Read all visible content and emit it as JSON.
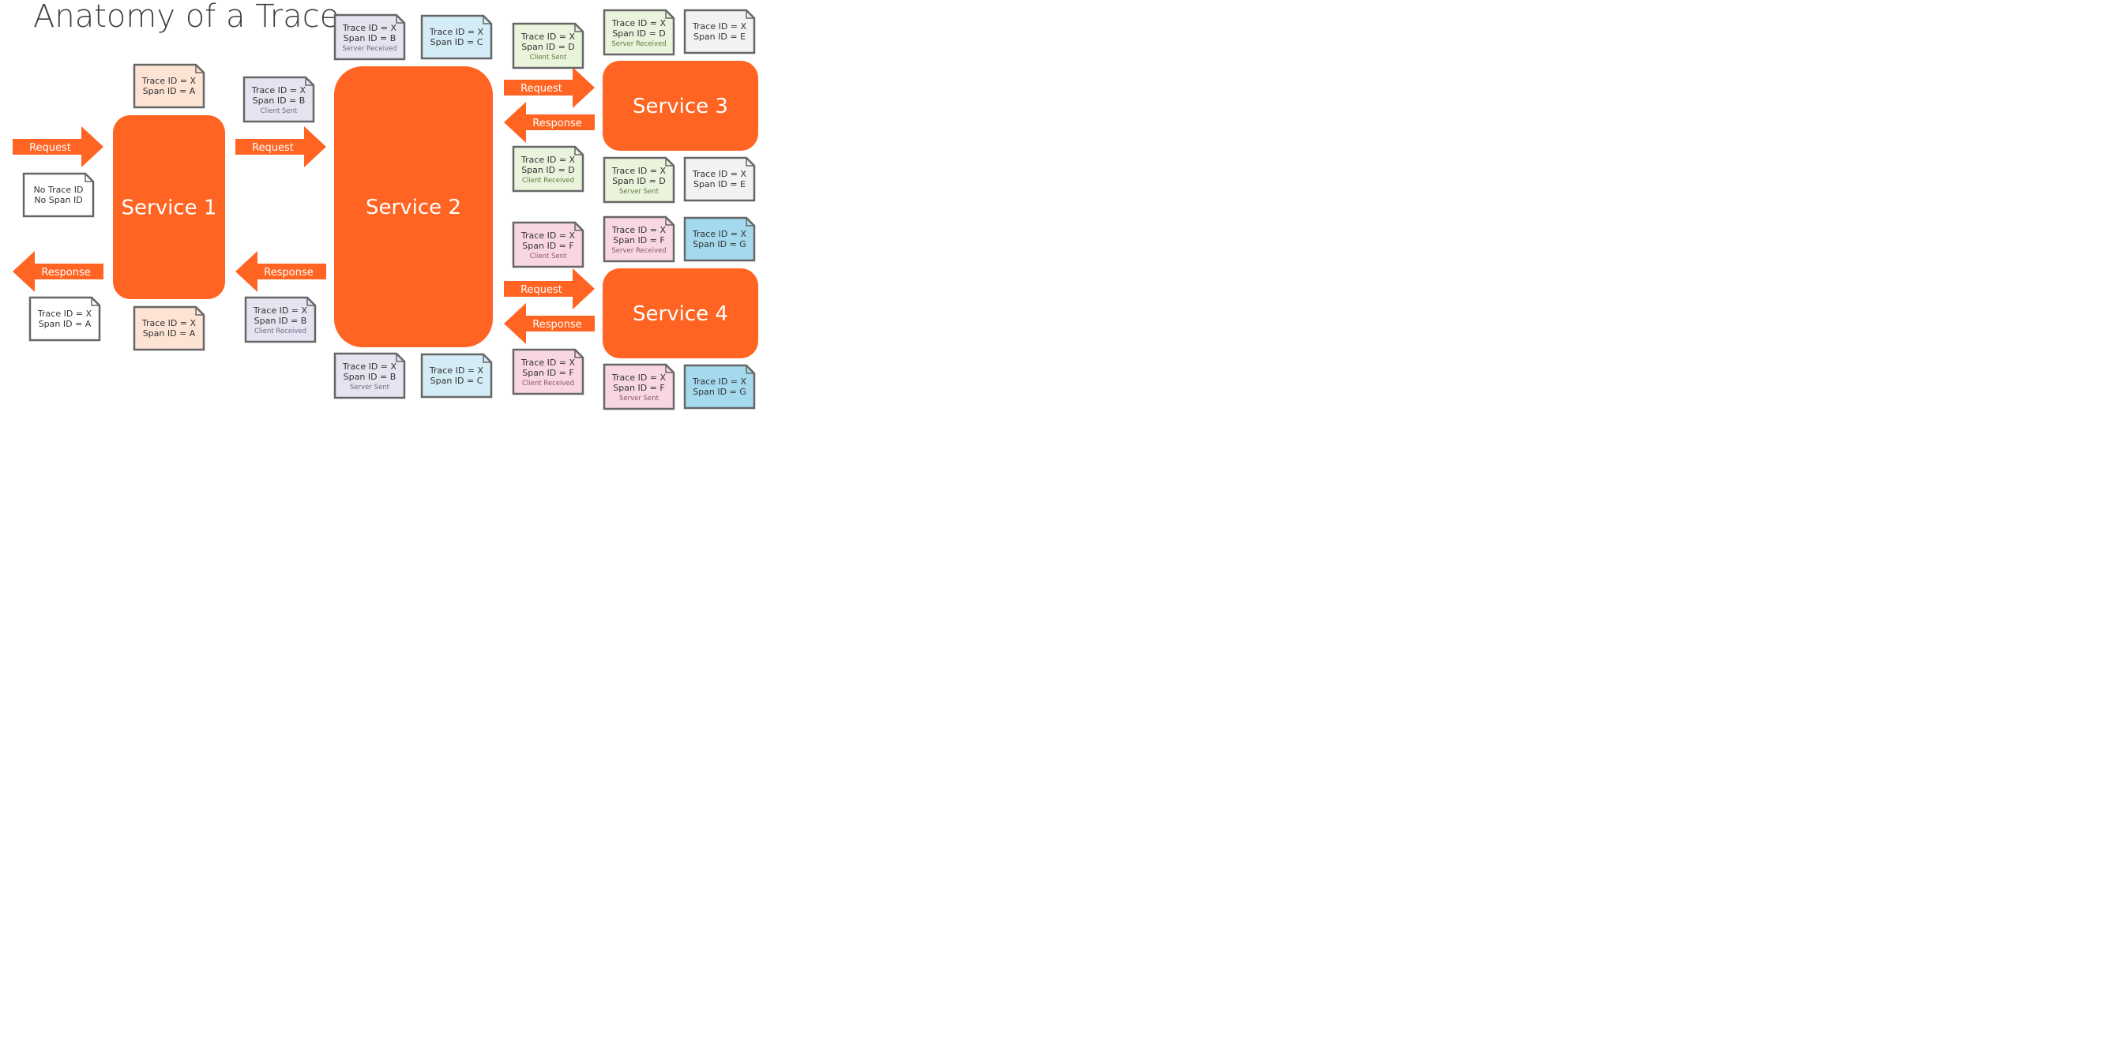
{
  "title": "Anatomy of a Trace",
  "colors": {
    "accent": "#ff6422",
    "service_text": "#ffffff",
    "note_border": "#666666",
    "peach": "#fde3d4",
    "lavender": "#e4e3ef",
    "light_blue": "#d3ecf6",
    "light_green": "#eaf3dc",
    "light_gray": "#f2f2f2",
    "pink": "#f8d7e1",
    "sky_blue": "#a4d9ee",
    "white": "#ffffff"
  },
  "services": [
    {
      "id": "service-1",
      "label": "Service 1"
    },
    {
      "id": "service-2",
      "label": "Service 2"
    },
    {
      "id": "service-3",
      "label": "Service 3"
    },
    {
      "id": "service-4",
      "label": "Service 4"
    }
  ],
  "arrows": [
    {
      "id": "client-request",
      "label": "Request",
      "direction": "right"
    },
    {
      "id": "client-response",
      "label": "Response",
      "direction": "left"
    },
    {
      "id": "s1-s2-request",
      "label": "Request",
      "direction": "right"
    },
    {
      "id": "s2-s1-response",
      "label": "Response",
      "direction": "left"
    },
    {
      "id": "s2-s3-request",
      "label": "Request",
      "direction": "right"
    },
    {
      "id": "s3-s2-response",
      "label": "Response",
      "direction": "left"
    },
    {
      "id": "s2-s4-request",
      "label": "Request",
      "direction": "right"
    },
    {
      "id": "s4-s2-response",
      "label": "Response",
      "direction": "left"
    }
  ],
  "notes": [
    {
      "id": "no-ids",
      "lines": [
        "No Trace ID",
        "No Span ID"
      ],
      "sub": "",
      "color": "white"
    },
    {
      "id": "client-response-a",
      "lines": [
        "Trace ID = X",
        "Span ID = A"
      ],
      "sub": "",
      "color": "white"
    },
    {
      "id": "s1-span-a-top",
      "lines": [
        "Trace ID = X",
        "Span ID = A"
      ],
      "sub": "",
      "color": "peach"
    },
    {
      "id": "s1-span-a-bottom",
      "lines": [
        "Trace ID = X",
        "Span ID = A"
      ],
      "sub": "",
      "color": "peach"
    },
    {
      "id": "b-client-sent",
      "lines": [
        "Trace ID = X",
        "Span ID = B"
      ],
      "sub": "Client Sent",
      "color": "lavender"
    },
    {
      "id": "b-client-received",
      "lines": [
        "Trace ID = X",
        "Span ID = B"
      ],
      "sub": "Client Received",
      "color": "lavender"
    },
    {
      "id": "b-server-received",
      "lines": [
        "Trace ID = X",
        "Span ID = B"
      ],
      "sub": "Server Received",
      "color": "lavender"
    },
    {
      "id": "c-top",
      "lines": [
        "Trace ID = X",
        "Span ID = C"
      ],
      "sub": "",
      "color": "light_blue"
    },
    {
      "id": "b-server-sent",
      "lines": [
        "Trace ID = X",
        "Span ID = B"
      ],
      "sub": "Server Sent",
      "color": "lavender"
    },
    {
      "id": "c-bottom",
      "lines": [
        "Trace ID = X",
        "Span ID = C"
      ],
      "sub": "",
      "color": "light_blue"
    },
    {
      "id": "d-client-sent",
      "lines": [
        "Trace ID = X",
        "Span ID = D"
      ],
      "sub": "Client Sent",
      "color": "light_green"
    },
    {
      "id": "d-client-received",
      "lines": [
        "Trace ID = X",
        "Span ID = D"
      ],
      "sub": "Client Received",
      "color": "light_green"
    },
    {
      "id": "d-server-received",
      "lines": [
        "Trace ID = X",
        "Span ID = D"
      ],
      "sub": "Server Received",
      "color": "light_green"
    },
    {
      "id": "e-top",
      "lines": [
        "Trace ID = X",
        "Span ID = E"
      ],
      "sub": "",
      "color": "light_gray"
    },
    {
      "id": "d-server-sent",
      "lines": [
        "Trace ID = X",
        "Span ID = D"
      ],
      "sub": "Server Sent",
      "color": "light_green"
    },
    {
      "id": "e-bottom",
      "lines": [
        "Trace ID = X",
        "Span ID = E"
      ],
      "sub": "",
      "color": "light_gray"
    },
    {
      "id": "f-client-sent",
      "lines": [
        "Trace ID = X",
        "Span ID = F"
      ],
      "sub": "Client Sent",
      "color": "pink"
    },
    {
      "id": "f-client-received",
      "lines": [
        "Trace ID = X",
        "Span ID = F"
      ],
      "sub": "Client Received",
      "color": "pink"
    },
    {
      "id": "f-server-received",
      "lines": [
        "Trace ID = X",
        "Span ID = F"
      ],
      "sub": "Server Received",
      "color": "pink"
    },
    {
      "id": "g-top",
      "lines": [
        "Trace ID = X",
        "Span ID = G"
      ],
      "sub": "",
      "color": "sky_blue"
    },
    {
      "id": "f-server-sent",
      "lines": [
        "Trace ID = X",
        "Span ID = F"
      ],
      "sub": "Server Sent",
      "color": "pink"
    },
    {
      "id": "g-bottom",
      "lines": [
        "Trace ID = X",
        "Span ID = G"
      ],
      "sub": "",
      "color": "sky_blue"
    }
  ]
}
